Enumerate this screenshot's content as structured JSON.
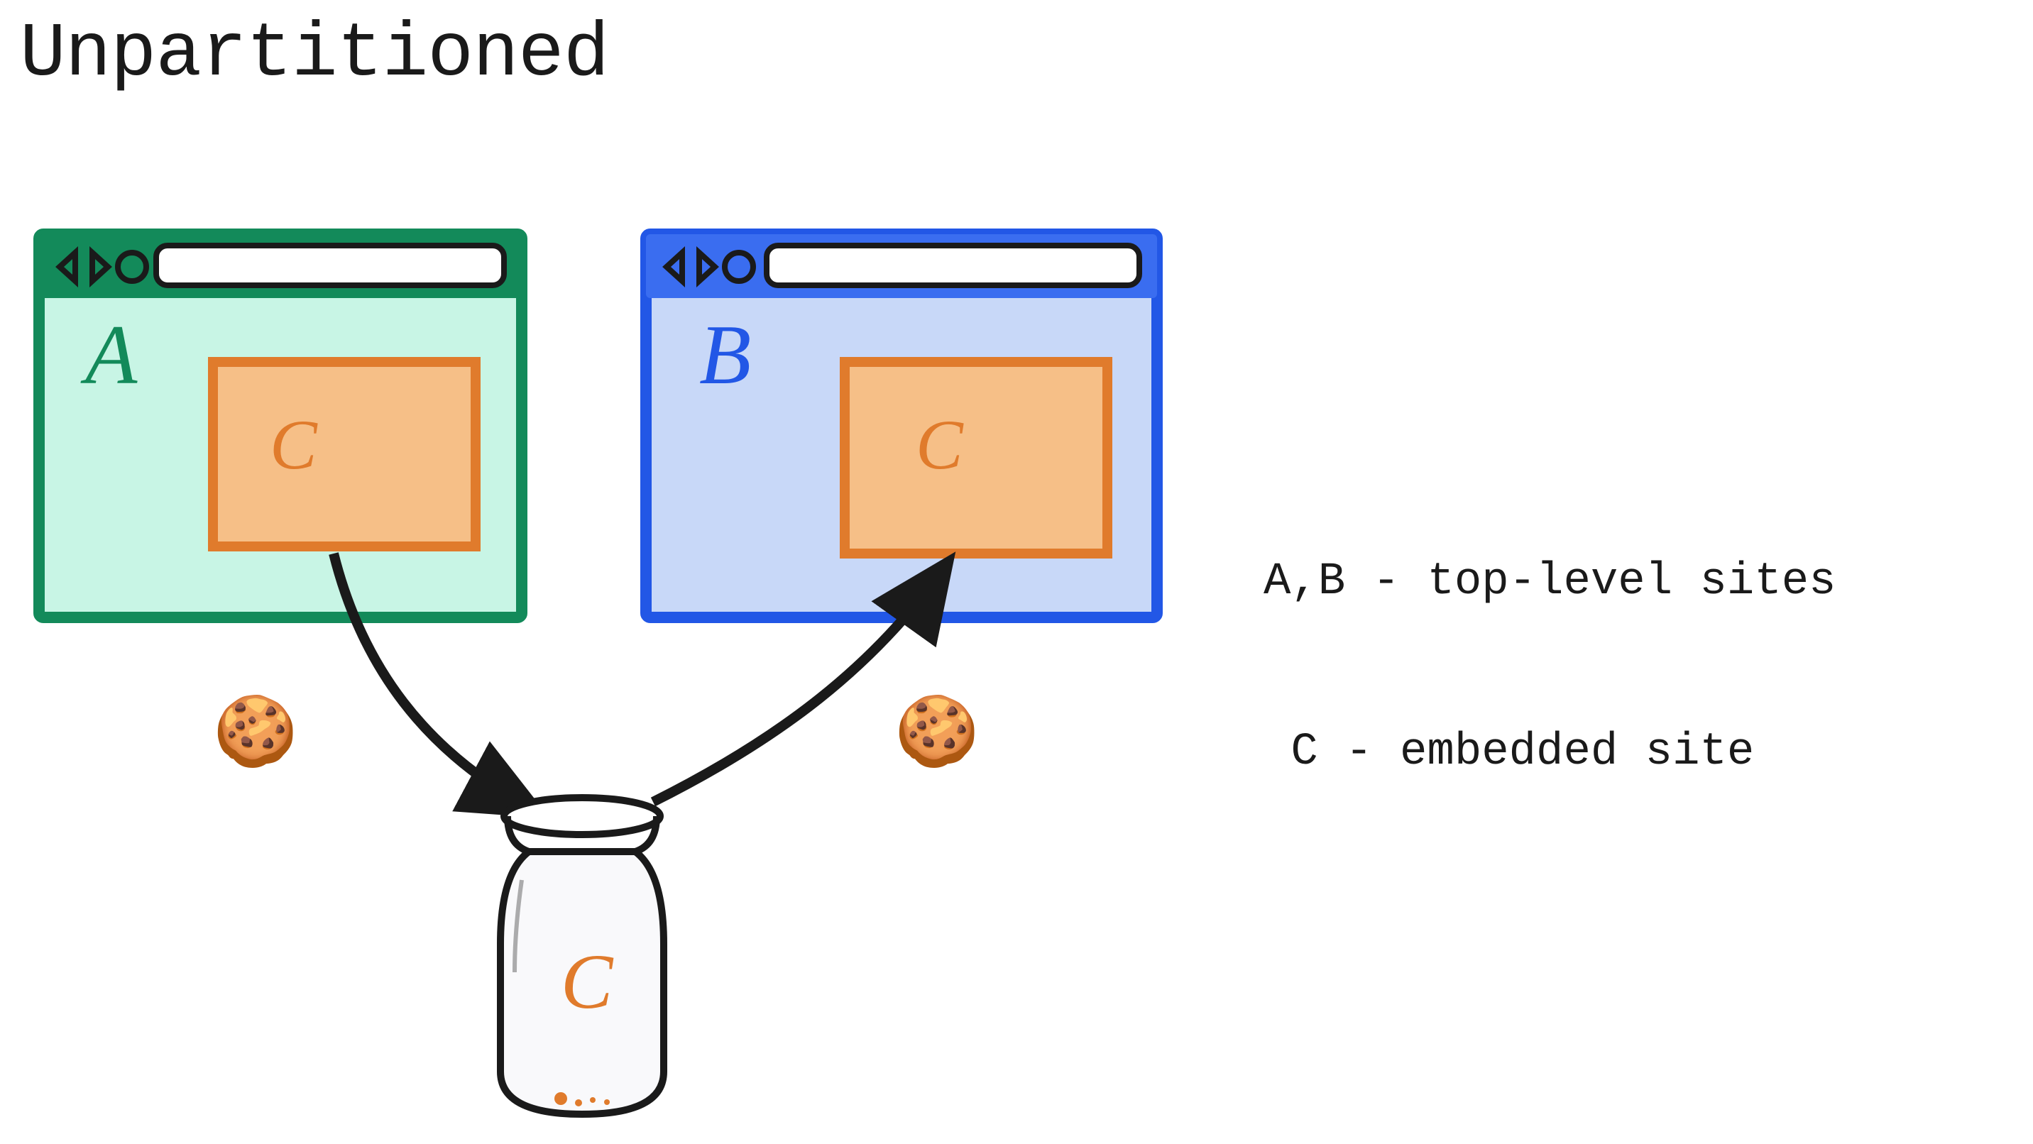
{
  "title": "Unpartitioned",
  "browser_a": {
    "label": "A",
    "embedded_label": "C"
  },
  "browser_b": {
    "label": "B",
    "embedded_label": "C"
  },
  "jar": {
    "label": "C"
  },
  "cookies": {
    "left": "🍪",
    "right": "🍪"
  },
  "legend": {
    "line1": "A,B - top-level sites",
    "line2": "C - embedded site"
  },
  "colors": {
    "green_stroke": "#138a5a",
    "green_fill": "#c8f5e5",
    "blue_stroke": "#2257e6",
    "blue_fill": "#c8d8f8",
    "orange_stroke": "#e07b2c",
    "orange_fill": "#f6bf87",
    "ink": "#1a1a1a"
  }
}
